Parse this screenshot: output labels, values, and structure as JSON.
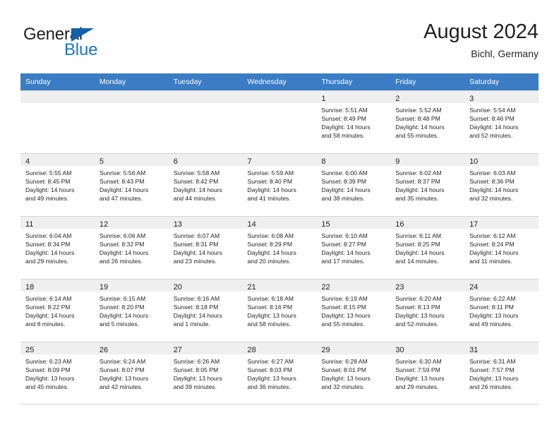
{
  "brand": {
    "name_part1": "General",
    "name_part2": "Blue",
    "triangle_icon": "triangle-icon",
    "colors": {
      "dark": "#231f20",
      "blue": "#1e76bd",
      "triangle": "#1261a8"
    }
  },
  "header": {
    "title": "August 2024",
    "location": "Bichl, Germany"
  },
  "theme": {
    "header_blue": "#3b7dc4",
    "cell_shade": "#efefef",
    "grid_line": "#d4d4d4"
  },
  "weekday_headers": [
    "Sunday",
    "Monday",
    "Tuesday",
    "Wednesday",
    "Thursday",
    "Friday",
    "Saturday"
  ],
  "weeks": [
    [
      {
        "day": "",
        "blank": true
      },
      {
        "day": "",
        "blank": true
      },
      {
        "day": "",
        "blank": true
      },
      {
        "day": "",
        "blank": true
      },
      {
        "day": "1",
        "sunrise": "Sunrise: 5:51 AM",
        "sunset": "Sunset: 8:49 PM",
        "daylight_line1": "Daylight: 14 hours",
        "daylight_line2": "and 58 minutes."
      },
      {
        "day": "2",
        "sunrise": "Sunrise: 5:52 AM",
        "sunset": "Sunset: 8:48 PM",
        "daylight_line1": "Daylight: 14 hours",
        "daylight_line2": "and 55 minutes."
      },
      {
        "day": "3",
        "sunrise": "Sunrise: 5:54 AM",
        "sunset": "Sunset: 8:46 PM",
        "daylight_line1": "Daylight: 14 hours",
        "daylight_line2": "and 52 minutes."
      }
    ],
    [
      {
        "day": "4",
        "sunrise": "Sunrise: 5:55 AM",
        "sunset": "Sunset: 8:45 PM",
        "daylight_line1": "Daylight: 14 hours",
        "daylight_line2": "and 49 minutes."
      },
      {
        "day": "5",
        "sunrise": "Sunrise: 5:56 AM",
        "sunset": "Sunset: 8:43 PM",
        "daylight_line1": "Daylight: 14 hours",
        "daylight_line2": "and 47 minutes."
      },
      {
        "day": "6",
        "sunrise": "Sunrise: 5:58 AM",
        "sunset": "Sunset: 8:42 PM",
        "daylight_line1": "Daylight: 14 hours",
        "daylight_line2": "and 44 minutes."
      },
      {
        "day": "7",
        "sunrise": "Sunrise: 5:59 AM",
        "sunset": "Sunset: 8:40 PM",
        "daylight_line1": "Daylight: 14 hours",
        "daylight_line2": "and 41 minutes."
      },
      {
        "day": "8",
        "sunrise": "Sunrise: 6:00 AM",
        "sunset": "Sunset: 8:39 PM",
        "daylight_line1": "Daylight: 14 hours",
        "daylight_line2": "and 38 minutes."
      },
      {
        "day": "9",
        "sunrise": "Sunrise: 6:02 AM",
        "sunset": "Sunset: 8:37 PM",
        "daylight_line1": "Daylight: 14 hours",
        "daylight_line2": "and 35 minutes."
      },
      {
        "day": "10",
        "sunrise": "Sunrise: 6:03 AM",
        "sunset": "Sunset: 8:36 PM",
        "daylight_line1": "Daylight: 14 hours",
        "daylight_line2": "and 32 minutes."
      }
    ],
    [
      {
        "day": "11",
        "sunrise": "Sunrise: 6:04 AM",
        "sunset": "Sunset: 8:34 PM",
        "daylight_line1": "Daylight: 14 hours",
        "daylight_line2": "and 29 minutes."
      },
      {
        "day": "12",
        "sunrise": "Sunrise: 6:06 AM",
        "sunset": "Sunset: 8:32 PM",
        "daylight_line1": "Daylight: 14 hours",
        "daylight_line2": "and 26 minutes."
      },
      {
        "day": "13",
        "sunrise": "Sunrise: 6:07 AM",
        "sunset": "Sunset: 8:31 PM",
        "daylight_line1": "Daylight: 14 hours",
        "daylight_line2": "and 23 minutes."
      },
      {
        "day": "14",
        "sunrise": "Sunrise: 6:08 AM",
        "sunset": "Sunset: 8:29 PM",
        "daylight_line1": "Daylight: 14 hours",
        "daylight_line2": "and 20 minutes."
      },
      {
        "day": "15",
        "sunrise": "Sunrise: 6:10 AM",
        "sunset": "Sunset: 8:27 PM",
        "daylight_line1": "Daylight: 14 hours",
        "daylight_line2": "and 17 minutes."
      },
      {
        "day": "16",
        "sunrise": "Sunrise: 6:11 AM",
        "sunset": "Sunset: 8:25 PM",
        "daylight_line1": "Daylight: 14 hours",
        "daylight_line2": "and 14 minutes."
      },
      {
        "day": "17",
        "sunrise": "Sunrise: 6:12 AM",
        "sunset": "Sunset: 8:24 PM",
        "daylight_line1": "Daylight: 14 hours",
        "daylight_line2": "and 11 minutes."
      }
    ],
    [
      {
        "day": "18",
        "sunrise": "Sunrise: 6:14 AM",
        "sunset": "Sunset: 8:22 PM",
        "daylight_line1": "Daylight: 14 hours",
        "daylight_line2": "and 8 minutes."
      },
      {
        "day": "19",
        "sunrise": "Sunrise: 6:15 AM",
        "sunset": "Sunset: 8:20 PM",
        "daylight_line1": "Daylight: 14 hours",
        "daylight_line2": "and 5 minutes."
      },
      {
        "day": "20",
        "sunrise": "Sunrise: 6:16 AM",
        "sunset": "Sunset: 8:18 PM",
        "daylight_line1": "Daylight: 14 hours",
        "daylight_line2": "and 1 minute."
      },
      {
        "day": "21",
        "sunrise": "Sunrise: 6:18 AM",
        "sunset": "Sunset: 8:16 PM",
        "daylight_line1": "Daylight: 13 hours",
        "daylight_line2": "and 58 minutes."
      },
      {
        "day": "22",
        "sunrise": "Sunrise: 6:19 AM",
        "sunset": "Sunset: 8:15 PM",
        "daylight_line1": "Daylight: 13 hours",
        "daylight_line2": "and 55 minutes."
      },
      {
        "day": "23",
        "sunrise": "Sunrise: 6:20 AM",
        "sunset": "Sunset: 8:13 PM",
        "daylight_line1": "Daylight: 13 hours",
        "daylight_line2": "and 52 minutes."
      },
      {
        "day": "24",
        "sunrise": "Sunrise: 6:22 AM",
        "sunset": "Sunset: 8:11 PM",
        "daylight_line1": "Daylight: 13 hours",
        "daylight_line2": "and 49 minutes."
      }
    ],
    [
      {
        "day": "25",
        "sunrise": "Sunrise: 6:23 AM",
        "sunset": "Sunset: 8:09 PM",
        "daylight_line1": "Daylight: 13 hours",
        "daylight_line2": "and 45 minutes."
      },
      {
        "day": "26",
        "sunrise": "Sunrise: 6:24 AM",
        "sunset": "Sunset: 8:07 PM",
        "daylight_line1": "Daylight: 13 hours",
        "daylight_line2": "and 42 minutes."
      },
      {
        "day": "27",
        "sunrise": "Sunrise: 6:26 AM",
        "sunset": "Sunset: 8:05 PM",
        "daylight_line1": "Daylight: 13 hours",
        "daylight_line2": "and 39 minutes."
      },
      {
        "day": "28",
        "sunrise": "Sunrise: 6:27 AM",
        "sunset": "Sunset: 8:03 PM",
        "daylight_line1": "Daylight: 13 hours",
        "daylight_line2": "and 36 minutes."
      },
      {
        "day": "29",
        "sunrise": "Sunrise: 6:28 AM",
        "sunset": "Sunset: 8:01 PM",
        "daylight_line1": "Daylight: 13 hours",
        "daylight_line2": "and 32 minutes."
      },
      {
        "day": "30",
        "sunrise": "Sunrise: 6:30 AM",
        "sunset": "Sunset: 7:59 PM",
        "daylight_line1": "Daylight: 13 hours",
        "daylight_line2": "and 29 minutes."
      },
      {
        "day": "31",
        "sunrise": "Sunrise: 6:31 AM",
        "sunset": "Sunset: 7:57 PM",
        "daylight_line1": "Daylight: 13 hours",
        "daylight_line2": "and 26 minutes."
      }
    ]
  ]
}
